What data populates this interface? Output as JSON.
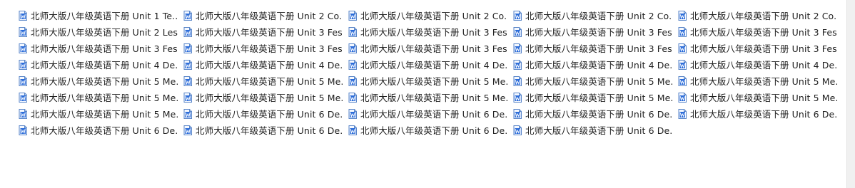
{
  "colors": {
    "icon_fill": "#2b6cd9",
    "icon_page": "#f4f8ff",
    "icon_border": "#5a86c8",
    "text": "#1e1e1e"
  },
  "files": [
    {
      "name": "北师大版八年级英语下册 Unit 1 Te...",
      "icon": "word-doc-icon"
    },
    {
      "name": "北师大版八年级英语下册 Unit 2 Co...",
      "icon": "word-doc-icon"
    },
    {
      "name": "北师大版八年级英语下册 Unit 2 Co...",
      "icon": "word-doc-icon"
    },
    {
      "name": "北师大版八年级英语下册 Unit 2 Co...",
      "icon": "word-doc-icon"
    },
    {
      "name": "北师大版八年级英语下册 Unit 2 Co...",
      "icon": "word-doc-icon"
    },
    {
      "name": "北师大版八年级英语下册 Unit 2 Les...",
      "icon": "word-doc-icon"
    },
    {
      "name": "北师大版八年级英语下册 Unit 3 Fes...",
      "icon": "word-doc-icon"
    },
    {
      "name": "北师大版八年级英语下册 Unit 3 Fes...",
      "icon": "word-doc-icon"
    },
    {
      "name": "北师大版八年级英语下册 Unit 3 Fes...",
      "icon": "word-doc-icon"
    },
    {
      "name": "北师大版八年级英语下册 Unit 3 Fes...",
      "icon": "word-doc-icon"
    },
    {
      "name": "北师大版八年级英语下册 Unit 3 Fes...",
      "icon": "word-doc-icon"
    },
    {
      "name": "北师大版八年级英语下册 Unit 3 Fes...",
      "icon": "word-doc-icon"
    },
    {
      "name": "北师大版八年级英语下册 Unit 3 Fes...",
      "icon": "word-doc-icon"
    },
    {
      "name": "北师大版八年级英语下册 Unit 3 Fes...",
      "icon": "word-doc-icon"
    },
    {
      "name": "北师大版八年级英语下册 Unit 3 Fes...",
      "icon": "word-doc-icon"
    },
    {
      "name": "北师大版八年级英语下册 Unit 4 De...",
      "icon": "word-doc-icon"
    },
    {
      "name": "北师大版八年级英语下册 Unit 4 De...",
      "icon": "word-doc-icon"
    },
    {
      "name": "北师大版八年级英语下册 Unit 4 De...",
      "icon": "word-doc-icon"
    },
    {
      "name": "北师大版八年级英语下册 Unit 4 De...",
      "icon": "word-doc-icon"
    },
    {
      "name": "北师大版八年级英语下册 Unit 4 De...",
      "icon": "word-doc-icon"
    },
    {
      "name": "北师大版八年级英语下册 Unit 5 Me...",
      "icon": "word-doc-icon"
    },
    {
      "name": "北师大版八年级英语下册 Unit 5 Me...",
      "icon": "word-doc-icon"
    },
    {
      "name": "北师大版八年级英语下册 Unit 5 Me...",
      "icon": "word-doc-icon"
    },
    {
      "name": "北师大版八年级英语下册 Unit 5 Me...",
      "icon": "word-doc-icon"
    },
    {
      "name": "北师大版八年级英语下册 Unit 5 Me...",
      "icon": "word-doc-icon"
    },
    {
      "name": "北师大版八年级英语下册 Unit 5 Me...",
      "icon": "word-doc-icon"
    },
    {
      "name": "北师大版八年级英语下册 Unit 5 Me...",
      "icon": "word-doc-icon"
    },
    {
      "name": "北师大版八年级英语下册 Unit 5 Me...",
      "icon": "word-doc-icon"
    },
    {
      "name": "北师大版八年级英语下册 Unit 5 Me...",
      "icon": "word-doc-icon"
    },
    {
      "name": "北师大版八年级英语下册 Unit 5 Me...",
      "icon": "word-doc-icon"
    },
    {
      "name": "北师大版八年级英语下册 Unit 5 Me...",
      "icon": "word-doc-icon"
    },
    {
      "name": "北师大版八年级英语下册 Unit 6 De...",
      "icon": "word-doc-icon"
    },
    {
      "name": "北师大版八年级英语下册 Unit 6 De...",
      "icon": "word-doc-icon"
    },
    {
      "name": "北师大版八年级英语下册 Unit 6 De...",
      "icon": "word-doc-icon"
    },
    {
      "name": "北师大版八年级英语下册 Unit 6 De...",
      "icon": "word-doc-icon"
    },
    {
      "name": "北师大版八年级英语下册 Unit 6 De...",
      "icon": "word-doc-icon"
    },
    {
      "name": "北师大版八年级英语下册 Unit 6 De...",
      "icon": "word-doc-icon"
    },
    {
      "name": "北师大版八年级英语下册 Unit 6 De...",
      "icon": "word-doc-icon"
    },
    {
      "name": "北师大版八年级英语下册 Unit 6 De...",
      "icon": "word-doc-icon"
    }
  ]
}
